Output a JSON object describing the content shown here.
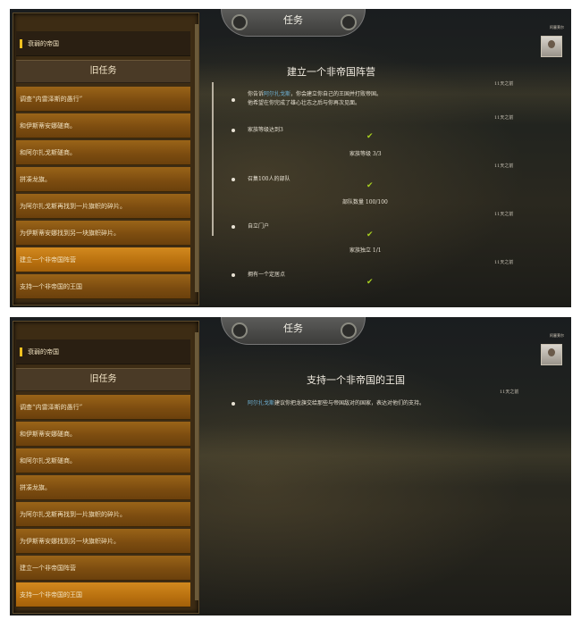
{
  "top": {
    "tab_title": "任务",
    "avatar_label": "阿塞莱尔",
    "current_quest": "衰弱的帝国",
    "old_header": "旧任务",
    "list": [
      "调查“内雷泽斯的愚行”",
      "和伊斯蒂安娜磋商。",
      "和阿尔扎戈斯磋商。",
      "拼凑龙旗。",
      "为阿尔扎戈斯再找到一片旗帜的碎片。",
      "为伊斯蒂安娜找到另一块旗帜碎片。",
      "建立一个非帝国阵营",
      "支持一个非帝国的王国"
    ],
    "quest_title": "建立一个非帝国阵营",
    "desc_pre": "你告诉",
    "desc_name": "阿尔扎戈斯",
    "desc_post": "，你会建立你自己的王国并打败帝国。",
    "desc_line2": "他希望在你完成了雄心壮志之后与你再次见面。",
    "days": [
      "11天之前",
      "11天之前",
      "11天之前",
      "11天之前",
      "11天之前"
    ],
    "obj1": "家族等级达到3",
    "prog1": "家族等级 3/3",
    "obj2": "召集100人的部队",
    "prog2": "部队数量 100/100",
    "obj3": "自立门户",
    "prog3": "家族独立 1/1",
    "obj4": "拥有一个定居点"
  },
  "bottom": {
    "tab_title": "任务",
    "avatar_label": "阿塞莱尔",
    "current_quest": "衰弱的帝国",
    "old_header": "旧任务",
    "list": [
      "调查“内雷泽斯的愚行”",
      "和伊斯蒂安娜磋商。",
      "和阿尔扎戈斯磋商。",
      "拼凑龙旗。",
      "为阿尔扎戈斯再找到一片旗帜的碎片。",
      "为伊斯蒂安娜找到另一块旗帜碎片。",
      "建立一个非帝国阵营",
      "支持一个非帝国的王国"
    ],
    "quest_title": "支持一个非帝国的王国",
    "desc_name": "阿尔扎戈斯",
    "desc_post": "建议你把龙旗交给那些与帝国敌对的国家，表达对他们的支持。",
    "days": "11天之前"
  },
  "colors": {
    "selected_row": "#c17c14",
    "row": "#8a5814",
    "check": "#a8d020",
    "highlight_name": "#6fb4d8"
  }
}
